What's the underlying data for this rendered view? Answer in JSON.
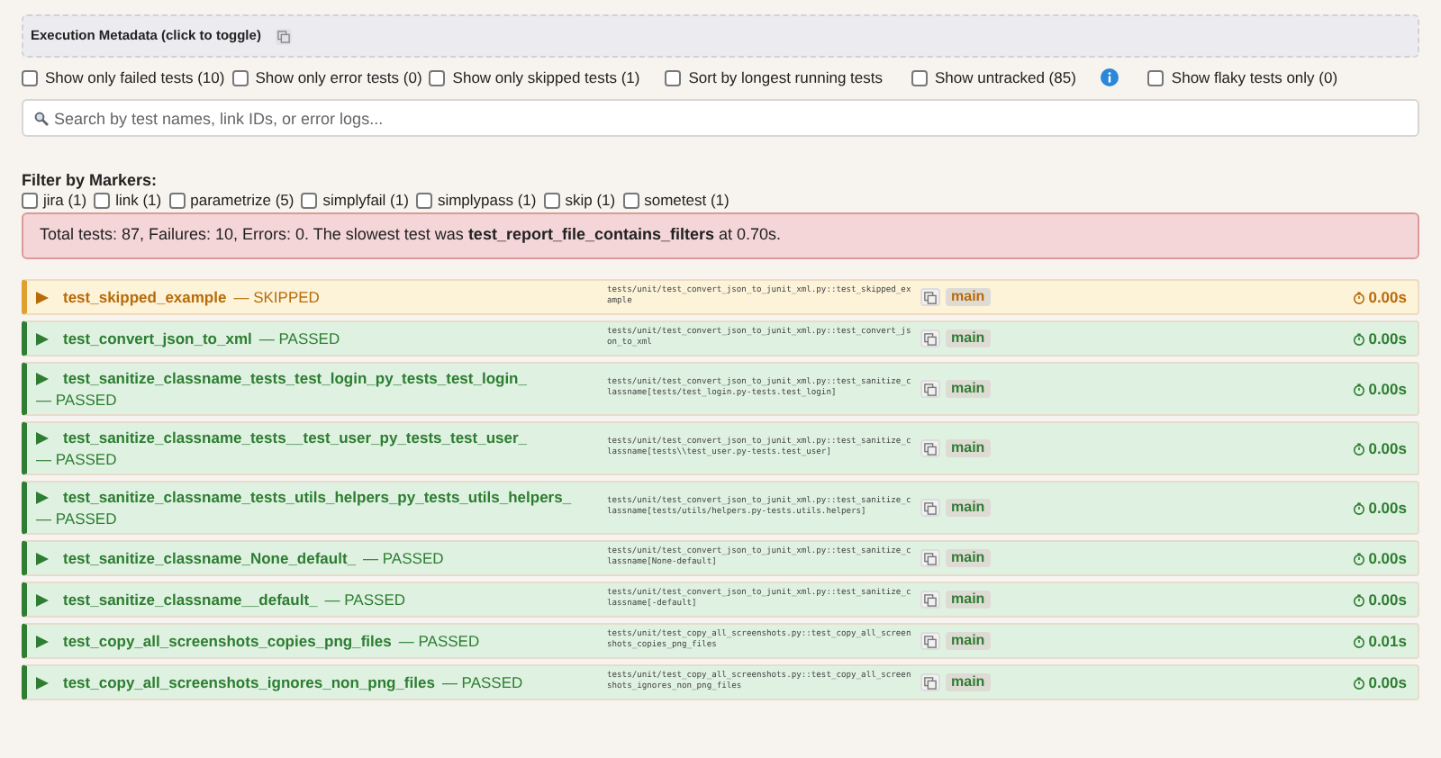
{
  "metadata": {
    "label": "Execution Metadata (click to toggle)"
  },
  "filters": [
    {
      "label": "Show only failed tests (10)",
      "checked": false
    },
    {
      "label": "Show only error tests (0)",
      "checked": false
    },
    {
      "label": "Show only skipped tests (1)",
      "checked": false
    },
    {
      "label": "Sort by longest running tests",
      "checked": false
    },
    {
      "label": "Show untracked (85)",
      "checked": false,
      "info": true
    },
    {
      "label": "Show flaky tests only (0)",
      "checked": false
    }
  ],
  "search": {
    "placeholder": "Search by test names, link IDs, or error logs..."
  },
  "markers": {
    "title": "Filter by Markers:",
    "items": [
      {
        "label": "jira (1)",
        "checked": false
      },
      {
        "label": "link (1)",
        "checked": false
      },
      {
        "label": "parametrize (5)",
        "checked": false
      },
      {
        "label": "simplyfail (1)",
        "checked": false
      },
      {
        "label": "simplypass (1)",
        "checked": false
      },
      {
        "label": "skip (1)",
        "checked": false
      },
      {
        "label": "sometest (1)",
        "checked": false
      }
    ]
  },
  "summary": "Total tests: 87, Failures: 10, Errors: 0. The slowest test was **test_report_file_contains_filters** at 0.70s.",
  "tests": [
    {
      "name": "test_skipped_example",
      "kind": "skipped",
      "status_label": "— SKIPPED",
      "nodeid": "tests/unit/test_convert_json_to_junit_xml.py::test_skipped_example",
      "branch": "main",
      "duration": "0.00s"
    },
    {
      "name": "test_convert_json_to_xml",
      "kind": "passed",
      "status_label": "— PASSED",
      "nodeid": "tests/unit/test_convert_json_to_junit_xml.py::test_convert_json_to_xml",
      "branch": "main",
      "duration": "0.00s"
    },
    {
      "name": "test_sanitize_classname_tests_test_login_py_tests_test_login_",
      "kind": "passed",
      "status_label": "— PASSED",
      "nodeid": "tests/unit/test_convert_json_to_junit_xml.py::test_sanitize_classname[tests/test_login.py-tests.test_login]",
      "branch": "main",
      "duration": "0.00s"
    },
    {
      "name": "test_sanitize_classname_tests__test_user_py_tests_test_user_",
      "kind": "passed",
      "status_label": "— PASSED",
      "nodeid": "tests/unit/test_convert_json_to_junit_xml.py::test_sanitize_classname[tests\\\\test_user.py-tests.test_user]",
      "branch": "main",
      "duration": "0.00s"
    },
    {
      "name": "test_sanitize_classname_tests_utils_helpers_py_tests_utils_helpers_",
      "kind": "passed",
      "status_label": "— PASSED",
      "nodeid": "tests/unit/test_convert_json_to_junit_xml.py::test_sanitize_classname[tests/utils/helpers.py-tests.utils.helpers]",
      "branch": "main",
      "duration": "0.00s"
    },
    {
      "name": "test_sanitize_classname_None_default_",
      "kind": "passed",
      "status_label": "— PASSED",
      "nodeid": "tests/unit/test_convert_json_to_junit_xml.py::test_sanitize_classname[None-default]",
      "branch": "main",
      "duration": "0.00s"
    },
    {
      "name": "test_sanitize_classname__default_",
      "kind": "passed",
      "status_label": "— PASSED",
      "nodeid": "tests/unit/test_convert_json_to_junit_xml.py::test_sanitize_classname[-default]",
      "branch": "main",
      "duration": "0.00s"
    },
    {
      "name": "test_copy_all_screenshots_copies_png_files",
      "kind": "passed",
      "status_label": "— PASSED",
      "nodeid": "tests/unit/test_copy_all_screenshots.py::test_copy_all_screenshots_copies_png_files",
      "branch": "main",
      "duration": "0.01s"
    },
    {
      "name": "test_copy_all_screenshots_ignores_non_png_files",
      "kind": "passed",
      "status_label": "— PASSED",
      "nodeid": "tests/unit/test_copy_all_screenshots.py::test_copy_all_screenshots_ignores_non_png_files",
      "branch": "main",
      "duration": "0.00s"
    }
  ]
}
